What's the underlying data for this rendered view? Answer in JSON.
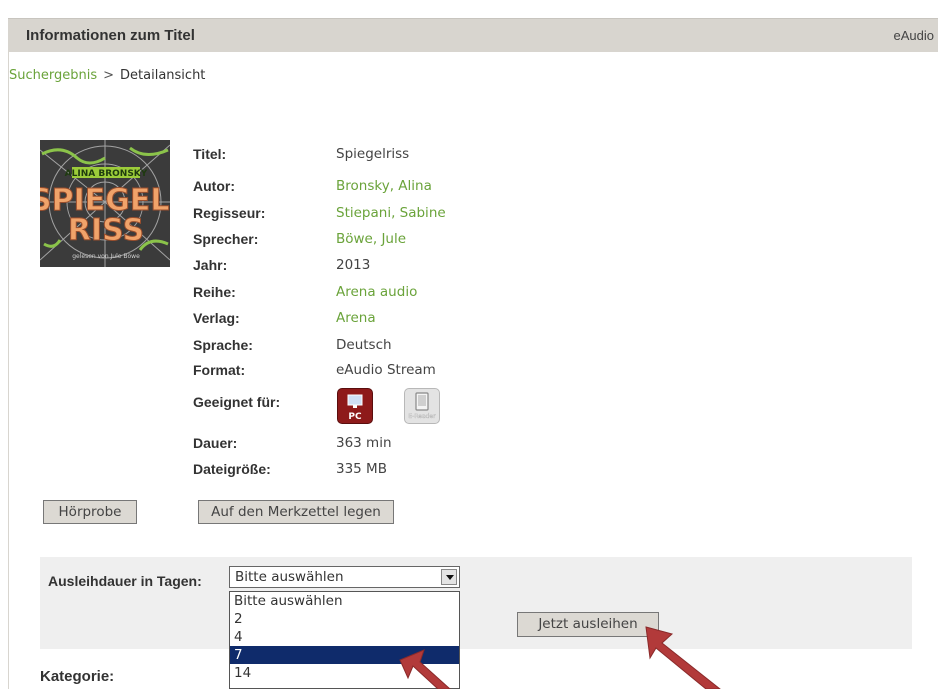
{
  "header": {
    "title": "Informationen zum Titel",
    "right_label": "eAudio"
  },
  "breadcrumb": {
    "link": "Suchergebnis",
    "separator": ">",
    "current": "Detailansicht"
  },
  "cover": {
    "author_text": "ALINA BRONSKY",
    "title_line1": "SPIEGEL-",
    "title_line2": "RISS",
    "subtitle": "gelesen von Jule Böwe"
  },
  "details": [
    {
      "label": "Titel:",
      "value": "Spiegelriss"
    },
    {
      "label": "Autor:",
      "value": "Bronsky, Alina"
    },
    {
      "label": "Regisseur:",
      "value": "Stiepani, Sabine"
    },
    {
      "label": "Sprecher:",
      "value": "Böwe, Jule"
    },
    {
      "label": "Jahr:",
      "value": "2013"
    },
    {
      "label": "Reihe:",
      "value": "Arena audio"
    },
    {
      "label": "Verlag:",
      "value": "Arena"
    },
    {
      "label": "Sprache:",
      "value": "Deutsch"
    },
    {
      "label": "Format:",
      "value": "eAudio Stream"
    },
    {
      "label": "Geeignet für:",
      "value": ""
    },
    {
      "label": "Dauer:",
      "value": "363 min"
    },
    {
      "label": "Dateigröße:",
      "value": "335 MB"
    }
  ],
  "devices": {
    "pc": "PC",
    "ereader": "E-Reader"
  },
  "buttons": {
    "sample": "Hörprobe",
    "watchlist": "Auf den Merkzettel legen",
    "borrow": "Jetzt ausleihen"
  },
  "loan": {
    "label": "Ausleihdauer in Tagen:",
    "selected": "Bitte auswählen",
    "options": [
      "Bitte auswählen",
      "2",
      "4",
      "7",
      "14"
    ],
    "highlighted_option": "7"
  },
  "category_label": "Kategorie:",
  "colors": {
    "link": "#6aa33a",
    "header_bg": "#d8d5cf",
    "highlight": "#0f2b6b",
    "annotation_arrow": "#b23a3a"
  }
}
